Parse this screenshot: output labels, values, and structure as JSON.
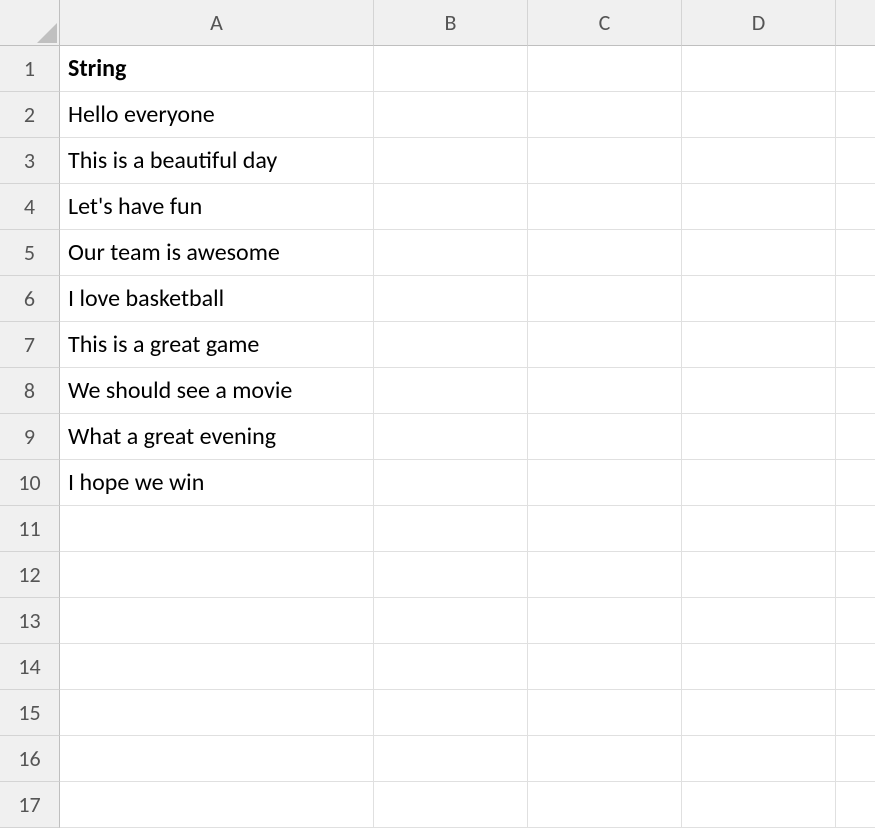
{
  "columns": [
    "A",
    "B",
    "C",
    "D",
    ""
  ],
  "rowCount": 17,
  "cells": {
    "A1": {
      "value": "String",
      "bold": true
    },
    "A2": {
      "value": "Hello everyone"
    },
    "A3": {
      "value": "This is a beautiful day"
    },
    "A4": {
      "value": "Let's have fun"
    },
    "A5": {
      "value": "Our team is awesome"
    },
    "A6": {
      "value": "I love basketball"
    },
    "A7": {
      "value": "This is a great game"
    },
    "A8": {
      "value": "We should see a movie"
    },
    "A9": {
      "value": "What a great evening"
    },
    "A10": {
      "value": "I hope we win"
    }
  }
}
